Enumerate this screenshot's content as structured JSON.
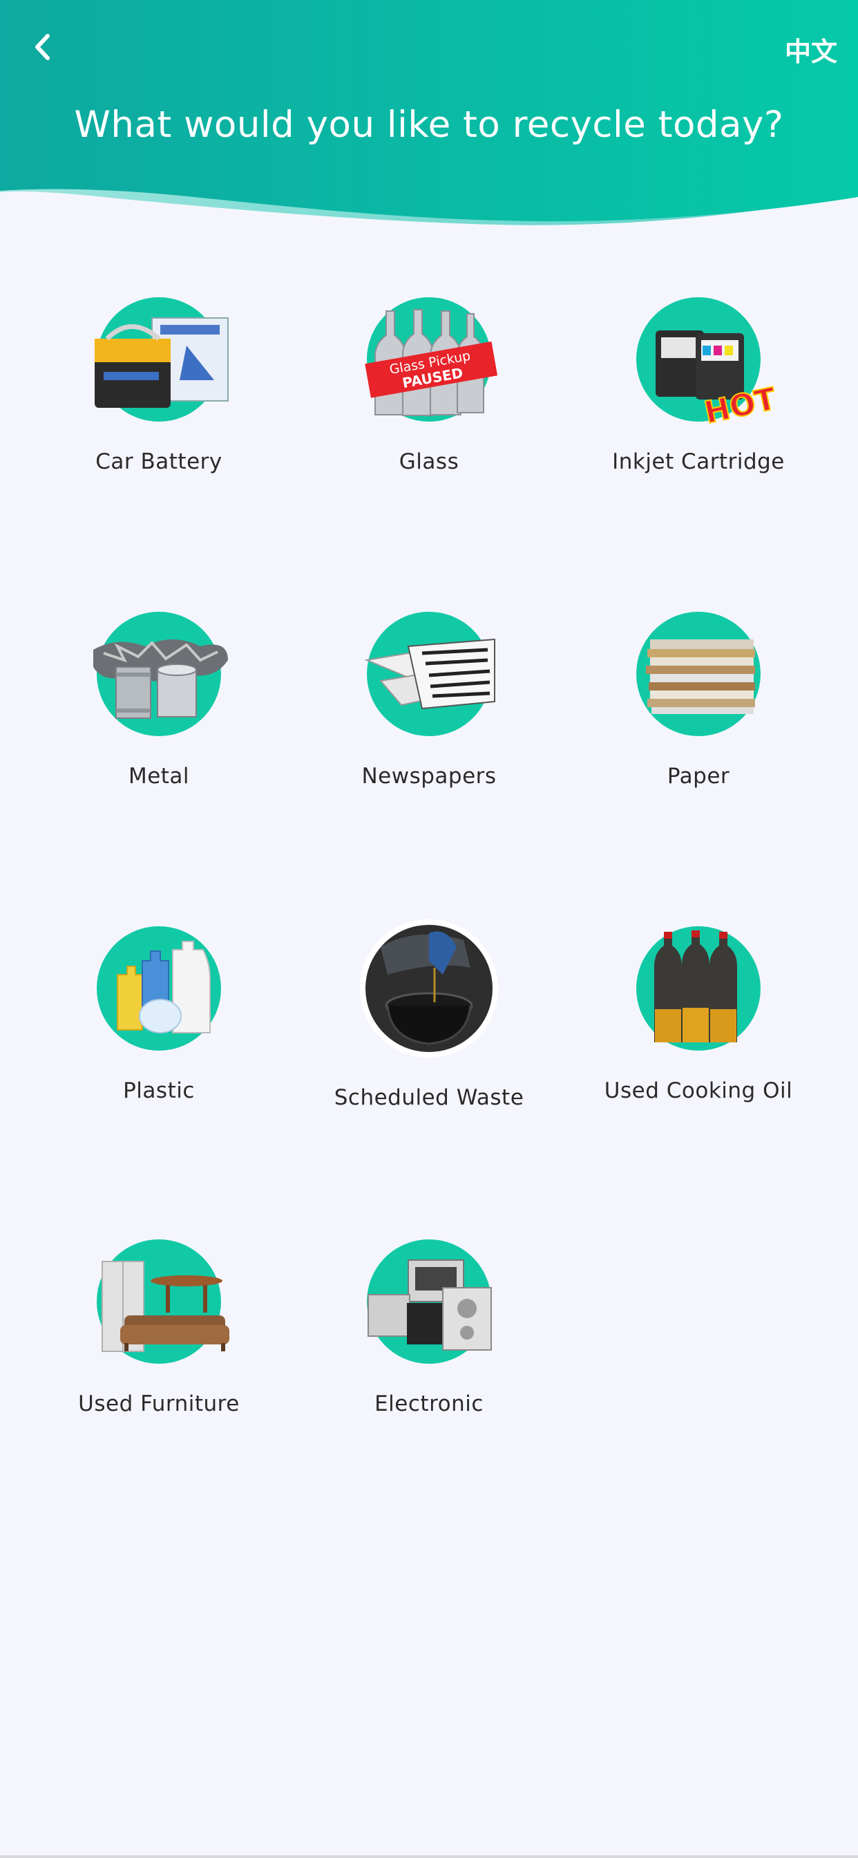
{
  "header": {
    "back_icon": "chevron-left-icon",
    "language_label": "中文",
    "title": "What would you like to recycle today?",
    "gradient_start": "#0ea9a0",
    "gradient_end": "#06c9a8"
  },
  "categories": [
    {
      "label": "Car Battery",
      "icon": "car-battery-icon"
    },
    {
      "label": "Glass",
      "icon": "glass-bottles-icon",
      "badge_line1": "Glass Pickup",
      "badge_line2": "PAUSED"
    },
    {
      "label": "Inkjet Cartridge",
      "icon": "inkjet-cartridge-icon",
      "badge": "HOT"
    },
    {
      "label": "Metal",
      "icon": "metal-cans-icon"
    },
    {
      "label": "Newspapers",
      "icon": "newspapers-icon"
    },
    {
      "label": "Paper",
      "icon": "paper-stack-icon"
    },
    {
      "label": "Plastic",
      "icon": "plastic-bottles-icon"
    },
    {
      "label": "Scheduled Waste",
      "icon": "scheduled-waste-icon"
    },
    {
      "label": "Used Cooking Oil",
      "icon": "cooking-oil-icon"
    },
    {
      "label": "Used Furniture",
      "icon": "furniture-icon"
    },
    {
      "label": "Electronic",
      "icon": "electronics-icon"
    }
  ],
  "colors": {
    "accent": "#12c9a6",
    "background": "#f5f6fd",
    "badge_red": "#e8232a"
  }
}
